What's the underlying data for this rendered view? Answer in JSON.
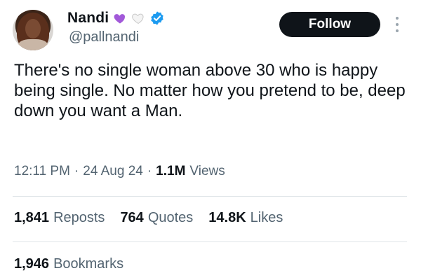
{
  "author": {
    "display_name": "Nandi",
    "handle": "@pallnandi",
    "name_emojis": [
      "purple-heart",
      "white-heart"
    ],
    "verified": true
  },
  "actions": {
    "follow_label": "Follow"
  },
  "tweet": {
    "text": "There's no single woman above 30 who is happy being single. No matter how you pretend to be, deep down you want a Man.",
    "time": "12:11 PM",
    "date": "24 Aug 24",
    "separator": "·",
    "views_count": "1.1M",
    "views_label": "Views"
  },
  "stats": {
    "reposts": {
      "num": "1,841",
      "label": "Reposts"
    },
    "quotes": {
      "num": "764",
      "label": "Quotes"
    },
    "likes": {
      "num": "14.8K",
      "label": "Likes"
    },
    "bookmarks": {
      "num": "1,946",
      "label": "Bookmarks"
    }
  },
  "colors": {
    "text": "#0f1419",
    "secondary_text": "#536471",
    "follow_bg": "#0f1419",
    "verified_blue": "#1d9bf0",
    "purple_heart": "#a259d9",
    "divider": "#dfe4e8"
  }
}
